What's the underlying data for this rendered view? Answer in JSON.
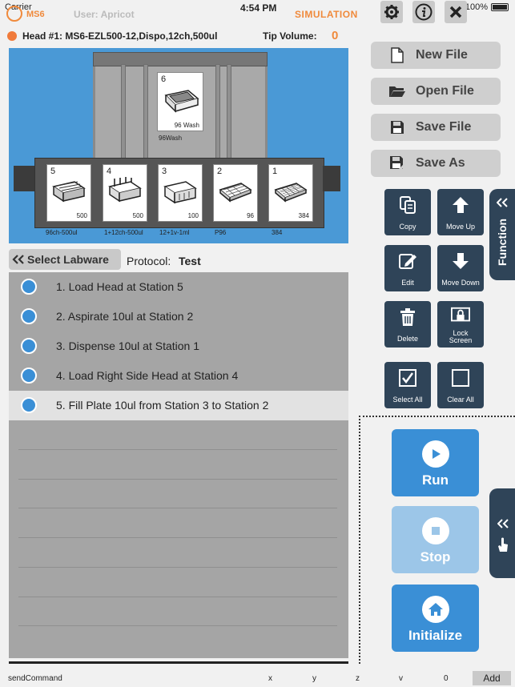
{
  "status_bar": {
    "carrier": "Carrier",
    "time": "4:54 PM",
    "battery": "100%"
  },
  "header": {
    "logo": "MS6",
    "user": "User:  Apricot",
    "mode": "SIMULATION",
    "icons": [
      "gear-icon",
      "info-icon",
      "close-icon"
    ]
  },
  "head_info": {
    "head": "Head #1: MS6-EZL500-12,Dispo,12ch,500ul",
    "tip_label": "Tip Volume:",
    "tip_value": "0"
  },
  "deck": {
    "bay6": {
      "number": "6",
      "value": "96 Wash",
      "caption": "96Wash"
    },
    "bays": [
      {
        "number": "5",
        "value": "500",
        "caption": "96ch-500ul"
      },
      {
        "number": "4",
        "value": "500",
        "caption": "1+12ch-500ul"
      },
      {
        "number": "3",
        "value": "100",
        "caption": "12+1v-1ml"
      },
      {
        "number": "2",
        "value": "96",
        "caption": "P96"
      },
      {
        "number": "1",
        "value": "384",
        "caption": "384"
      }
    ]
  },
  "labware": {
    "select_label": "Select Labware",
    "protocol_label": "Protocol:",
    "protocol_name": "Test"
  },
  "steps": [
    {
      "label": "1. Load Head at Station 5"
    },
    {
      "label": "2. Aspirate 10ul at Station 2"
    },
    {
      "label": "3. Dispense 10ul at Station 1"
    },
    {
      "label": "4. Load Right Side Head at Station 4"
    },
    {
      "label": "5. Fill Plate 10ul from Station 3 to Station 2"
    }
  ],
  "file_buttons": {
    "new": "New File",
    "open": "Open File",
    "save": "Save File",
    "save_as": "Save As"
  },
  "tools": {
    "copy": "Copy",
    "move_up": "Move Up",
    "edit": "Edit",
    "move_down": "Move Down",
    "delete": "Delete",
    "lock_screen": "Lock Screen",
    "select_all": "Select All",
    "clear_all": "Clear All"
  },
  "function_tab": "Function",
  "actions": {
    "run": "Run",
    "stop": "Stop",
    "initialize": "Initialize"
  },
  "colors": {
    "accent": "#f08a3c",
    "deck": "#4a99d6",
    "tile": "#2f4458",
    "action": "#3a8fd6",
    "action_disabled": "#9cc6e8"
  },
  "footer": {
    "command": "sendCommand",
    "x_label": "x",
    "y_label": "y",
    "z_label": "z",
    "v_label": "v",
    "v_value": "0",
    "add": "Add"
  }
}
